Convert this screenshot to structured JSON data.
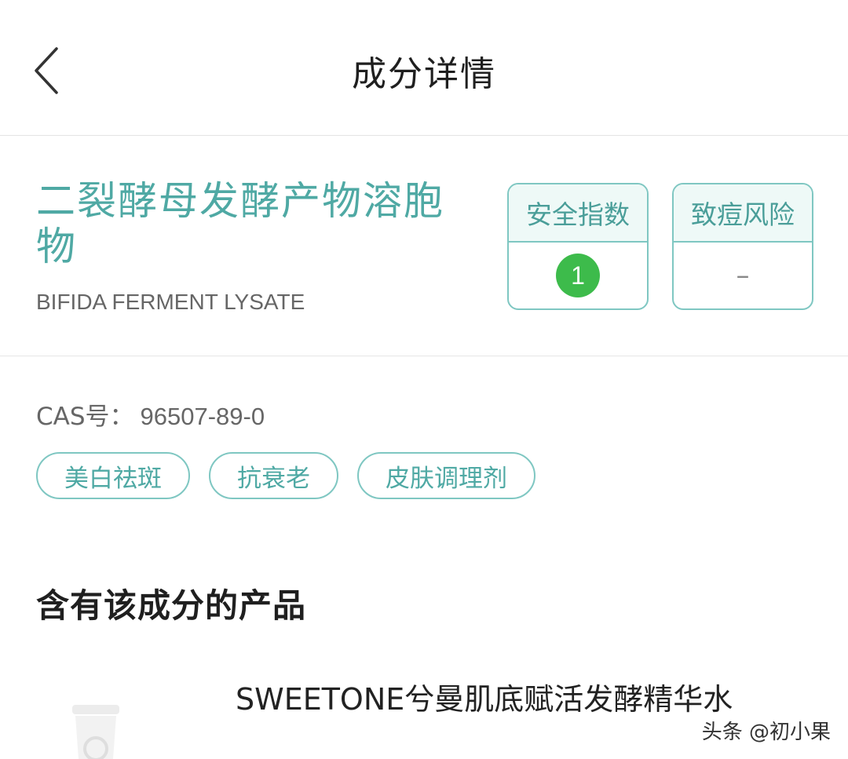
{
  "header": {
    "title": "成分详情",
    "back_icon": "chevron-left-icon"
  },
  "ingredient": {
    "name_cn": "二裂酵母发酵产物溶胞物",
    "name_en": "BIFIDA FERMENT LYSATE",
    "safety": {
      "label": "安全指数",
      "value": "1",
      "color": "#3dbb4b"
    },
    "acne_risk": {
      "label": "致痘风险",
      "value": "–"
    }
  },
  "cas": {
    "label": "CAS号：",
    "value": "96507-89-0"
  },
  "tags": [
    "美白祛斑",
    "抗衰老",
    "皮肤调理剂"
  ],
  "products_section": {
    "title": "含有该成分的产品"
  },
  "products": [
    {
      "name": "SWEETONE兮曼肌底赋活发酵精华水",
      "thumb_icon": "product-bottle-icon"
    }
  ],
  "watermark": "头条 @初小果",
  "colors": {
    "accent": "#4fa9a4",
    "border": "#7fc7c2",
    "badge": "#3dbb4b"
  }
}
